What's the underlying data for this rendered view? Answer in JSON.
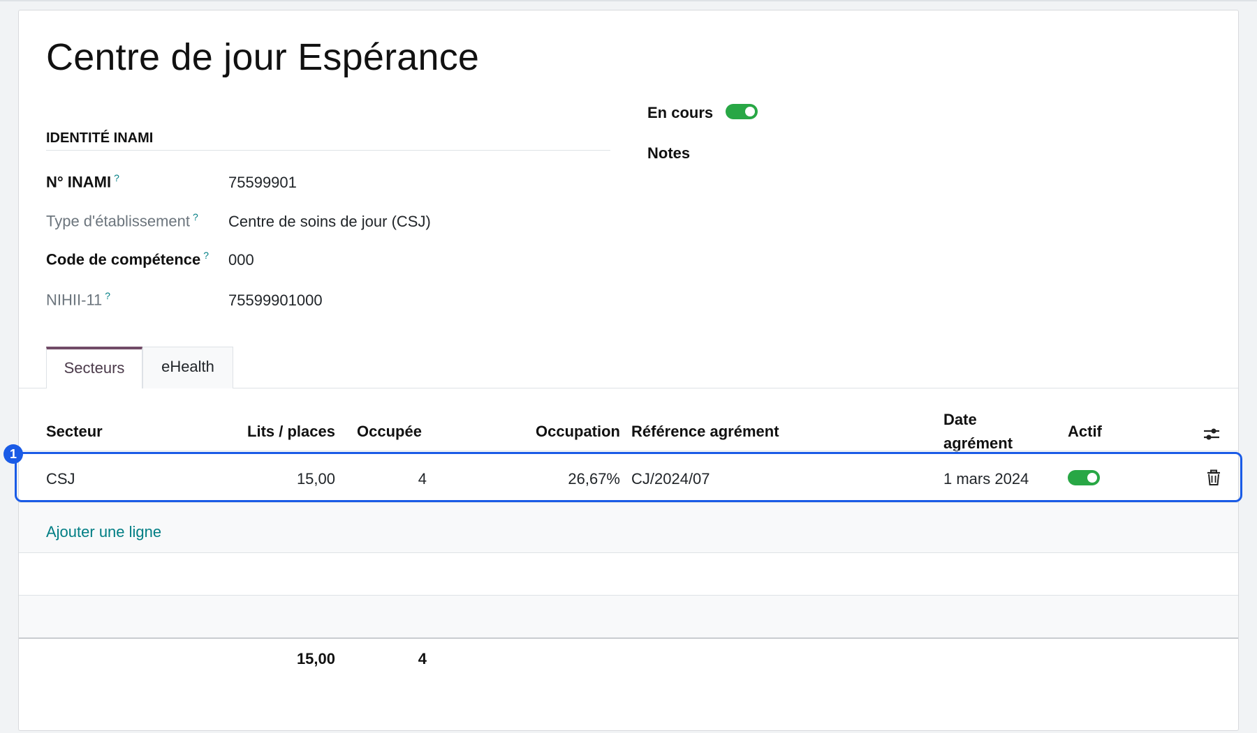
{
  "record": {
    "title": "Centre de jour Espérance"
  },
  "identity": {
    "group_title": "IDENTITÉ INAMI",
    "fields": [
      {
        "label": "N° INAMI",
        "help": "?",
        "value": "75599901"
      },
      {
        "label": "Type d'établissement",
        "help": "?",
        "value": "Centre de soins de jour (CSJ)"
      },
      {
        "label": "Code de compétence",
        "help": "?",
        "value": "000"
      },
      {
        "label": "NIHII-11",
        "help": "?",
        "value": "75599901000"
      }
    ]
  },
  "status": {
    "en_cours_label": "En cours",
    "en_cours_on": true,
    "notes_label": "Notes"
  },
  "tabs": [
    {
      "label": "Secteurs",
      "active": true
    },
    {
      "label": "eHealth",
      "active": false
    }
  ],
  "table": {
    "headers": {
      "secteur": "Secteur",
      "lits": "Lits / places",
      "occupee": "Occupée",
      "occupation": "Occupation",
      "reference": "Référence agrément",
      "date_line1": "Date",
      "date_line2": "agrément",
      "actif": "Actif"
    },
    "rows": [
      {
        "secteur": "CSJ",
        "lits": "15,00",
        "occupee": "4",
        "occupation": "26,67%",
        "reference": "CJ/2024/07",
        "date": "1 mars 2024",
        "actif": true
      }
    ],
    "add_line": "Ajouter une ligne",
    "totals": {
      "lits": "15,00",
      "occupee": "4"
    },
    "selection_badge": "1"
  },
  "colors": {
    "accent": "#714b67",
    "link": "#017e84",
    "toggle_on": "#28a745",
    "highlight": "#1a5be6"
  },
  "icons": [
    "settings-sliders-icon",
    "trash-icon"
  ]
}
